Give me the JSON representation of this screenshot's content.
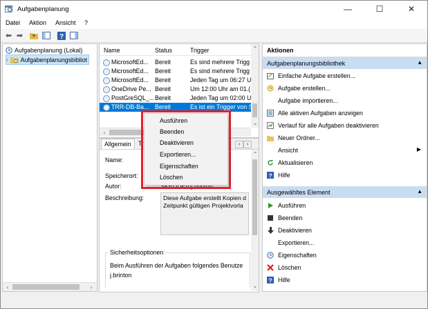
{
  "window": {
    "title": "Aufgabenplanung",
    "minimize": "—",
    "maximize": "☐",
    "close": "✕"
  },
  "menu": [
    "Datei",
    "Aktion",
    "Ansicht",
    "?"
  ],
  "tree": {
    "root": "Aufgabenplanung (Lokal)",
    "child": "Aufgabenplanungsbibliot"
  },
  "task_table": {
    "columns": [
      "Name",
      "Status",
      "Trigger"
    ],
    "rows": [
      {
        "name": "MicrosoftEd...",
        "status": "Bereit",
        "trigger": "Es sind mehrere Trigg"
      },
      {
        "name": "MicrosoftEd...",
        "status": "Bereit",
        "trigger": "Es sind mehrere Trigg"
      },
      {
        "name": "MicrosoftEd...",
        "status": "Bereit",
        "trigger": "Jeden Tag um 06:27 U"
      },
      {
        "name": "OneDrive Pe...",
        "status": "Bereit",
        "trigger": "Um 12:00 Uhr am 01.("
      },
      {
        "name": "PostGreSQL_...",
        "status": "Bereit",
        "trigger": "Jeden Tag um 02:00 U"
      },
      {
        "name": "TRR-DB-Ba...",
        "status": "Bereit",
        "trigger": "Es ist ein Trigger von S"
      }
    ]
  },
  "details": {
    "tabs": [
      "Allgemein",
      "Tr"
    ],
    "name_label": "Name:",
    "location_label": "Speicherort:",
    "author_label": "Autor:",
    "author_value": "SKEDDEV\\j.brinton",
    "description_label": "Beschreibung:",
    "description_text": "Diese Aufgabe erstellt Kopien d",
    "description_text2": "Zeitpunkt gültigen Projektvorla",
    "security_heading": "Sicherheitsoptionen",
    "security_text": "Beim Ausführen der Aufgaben folgendes Benutze",
    "security_user": "j.brinton"
  },
  "context_menu": [
    "Ausführen",
    "Beenden",
    "Deaktivieren",
    "Exportieren...",
    "Eigenschaften",
    "Löschen"
  ],
  "actions": {
    "title": "Aktionen",
    "section1": "Aufgabenplanungsbibliothek",
    "items1": [
      {
        "label": "Einfache Aufgabe erstellen...",
        "icon": "wizard-icon"
      },
      {
        "label": "Aufgabe erstellen...",
        "icon": "task-create-icon"
      },
      {
        "label": "Aufgabe importieren...",
        "icon": "none"
      },
      {
        "label": "Alle aktiven Aufgaben anzeigen",
        "icon": "list-icon"
      },
      {
        "label": "Verlauf für alle Aufgaben deaktivieren",
        "icon": "history-icon"
      },
      {
        "label": "Neuer Ordner...",
        "icon": "folder-icon"
      },
      {
        "label": "Ansicht",
        "icon": "none"
      },
      {
        "label": "Aktualisieren",
        "icon": "refresh-icon"
      },
      {
        "label": "Hilfe",
        "icon": "help-icon"
      }
    ],
    "section2": "Ausgewähltes Element",
    "items2": [
      {
        "label": "Ausführen",
        "icon": "play-icon"
      },
      {
        "label": "Beenden",
        "icon": "stop-icon"
      },
      {
        "label": "Deaktivieren",
        "icon": "down-arrow-icon"
      },
      {
        "label": "Exportieren...",
        "icon": "none"
      },
      {
        "label": "Eigenschaften",
        "icon": "clock-icon"
      },
      {
        "label": "Löschen",
        "icon": "delete-icon"
      },
      {
        "label": "Hilfe",
        "icon": "help-icon"
      }
    ]
  },
  "colors": {
    "selection": "#0078d7",
    "section_header": "#c9ddf2",
    "highlight": "#e2202a"
  }
}
